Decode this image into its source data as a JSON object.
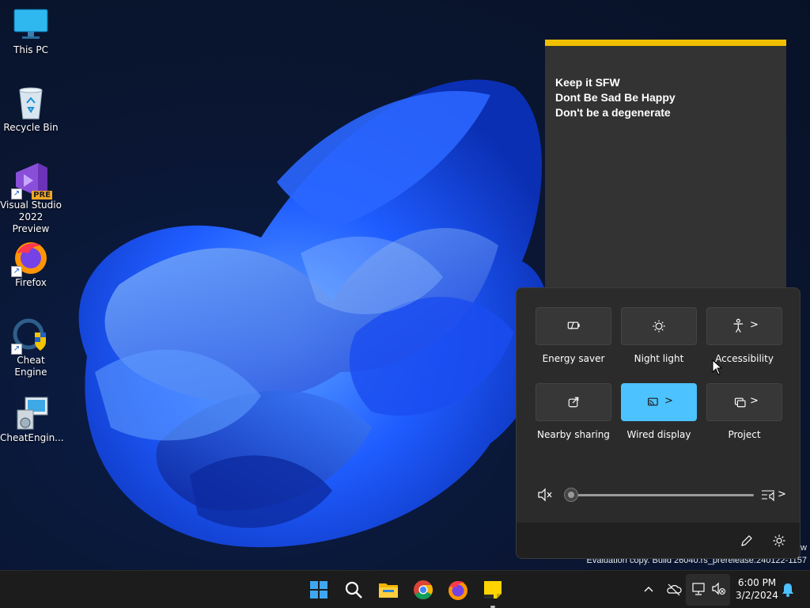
{
  "desktop": {
    "icons": [
      {
        "label": "This PC",
        "icon": "monitor-icon"
      },
      {
        "label": "Recycle Bin",
        "icon": "recycle-bin-icon"
      },
      {
        "label": "Visual Studio 2022 Preview",
        "icon": "visual-studio-icon",
        "badge": "PRE"
      },
      {
        "label": "Firefox",
        "icon": "firefox-icon"
      },
      {
        "label": "Cheat Engine",
        "icon": "cheat-engine-icon"
      },
      {
        "label": "CheatEngin...",
        "icon": "installer-icon"
      }
    ]
  },
  "sticky_note": {
    "lines": [
      "Keep it SFW",
      "Dont Be Sad Be Happy",
      "Don't be a degenerate"
    ],
    "accent": "#f0c000"
  },
  "quick_settings": {
    "tiles": [
      {
        "label": "Energy saver",
        "icon": "energy-saver-icon",
        "active": false,
        "chevron": ""
      },
      {
        "label": "Night light",
        "icon": "night-light-icon",
        "active": false,
        "chevron": ""
      },
      {
        "label": "Accessibility",
        "icon": "accessibility-icon",
        "active": false,
        "chevron": ">"
      },
      {
        "label": "Nearby sharing",
        "icon": "nearby-sharing-icon",
        "active": false,
        "chevron": ""
      },
      {
        "label": "Wired display",
        "icon": "cast-icon",
        "active": true,
        "chevron": ">"
      },
      {
        "label": "Project",
        "icon": "project-icon",
        "active": false,
        "chevron": ">"
      }
    ],
    "volume": {
      "level": 0,
      "muted": true,
      "chevron": ">"
    },
    "accent": "#4cc2ff"
  },
  "watermark": {
    "line1": "w",
    "line2": "Evaluation copy. Build 26040.rs_prerelease.240122-1157"
  },
  "taskbar": {
    "pinned": [
      "start-icon",
      "search-icon",
      "file-explorer-icon",
      "chrome-icon",
      "firefox-icon",
      "sticky-notes-icon"
    ],
    "time": "6:00 PM",
    "date": "3/2/2024"
  }
}
